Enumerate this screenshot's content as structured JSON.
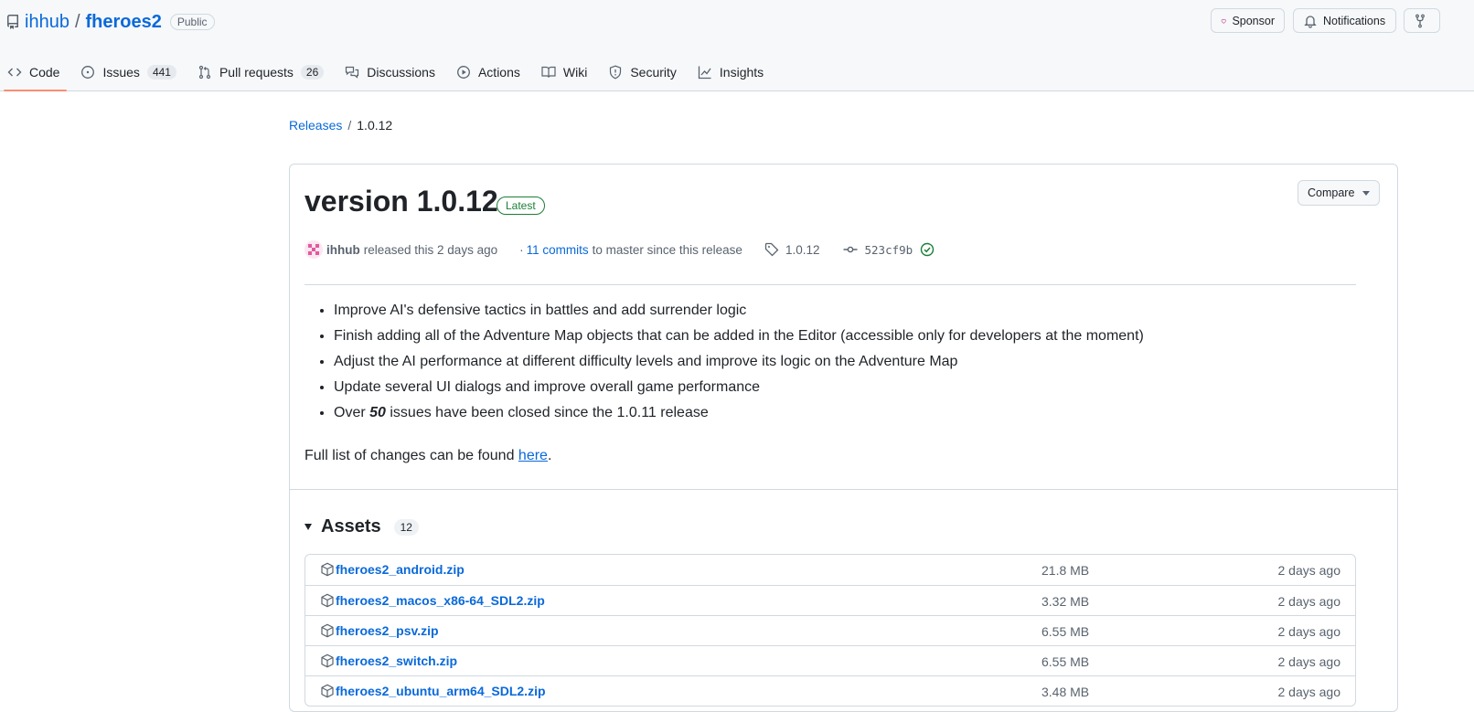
{
  "repo": {
    "owner": "ihhub",
    "separator": "/",
    "name": "fheroes2",
    "visibility": "Public",
    "icon": "repo-icon"
  },
  "header_actions": {
    "sponsor_label": "Sponsor",
    "notifications_label": "Notifications"
  },
  "tabs": [
    {
      "label": "Code",
      "icon": "code-icon",
      "count": null,
      "active": true
    },
    {
      "label": "Issues",
      "icon": "issue-icon",
      "count": "441",
      "active": false
    },
    {
      "label": "Pull requests",
      "icon": "pull-request-icon",
      "count": "26",
      "active": false
    },
    {
      "label": "Discussions",
      "icon": "comment-discussion-icon",
      "count": null,
      "active": false
    },
    {
      "label": "Actions",
      "icon": "play-icon",
      "count": null,
      "active": false
    },
    {
      "label": "Wiki",
      "icon": "book-icon",
      "count": null,
      "active": false
    },
    {
      "label": "Security",
      "icon": "shield-icon",
      "count": null,
      "active": false
    },
    {
      "label": "Insights",
      "icon": "graph-icon",
      "count": null,
      "active": false
    }
  ],
  "breadcrumb": {
    "releases_label": "Releases",
    "separator": "/",
    "current": "1.0.12"
  },
  "release": {
    "title": "version 1.0.12",
    "badge": "Latest",
    "compare_label": "Compare",
    "author": "ihhub",
    "released_text": "released this 2 days ago",
    "dot": "·",
    "commits_link": "11 commits",
    "commits_suffix": "to master since this release",
    "tag": "1.0.12",
    "commit_sha": "523cf9b",
    "notes_parts": [
      {
        "text": "Improve AI's defensive tactics in battles and add surrender logic"
      },
      {
        "text": "Finish adding all of the Adventure Map objects that can be added in the Editor (accessible only for developers at the moment)"
      },
      {
        "text": "Adjust the AI performance at different difficulty levels and improve its logic on the Adventure Map"
      },
      {
        "text": "Update several UI dialogs and improve overall game performance"
      }
    ],
    "last_note": {
      "prefix": "Over ",
      "emphasis": "50",
      "suffix": " issues have been closed since the 1.0.11 release"
    },
    "full_list": {
      "prefix": "Full list of changes can be found ",
      "link": "here",
      "suffix": "."
    }
  },
  "assets": {
    "title": "Assets",
    "count": "12",
    "items": [
      {
        "name": "fheroes2_android.zip",
        "size": "21.8 MB",
        "date": "2 days ago"
      },
      {
        "name": "fheroes2_macos_x86-64_SDL2.zip",
        "size": "3.32 MB",
        "date": "2 days ago"
      },
      {
        "name": "fheroes2_psv.zip",
        "size": "6.55 MB",
        "date": "2 days ago"
      },
      {
        "name": "fheroes2_switch.zip",
        "size": "6.55 MB",
        "date": "2 days ago"
      },
      {
        "name": "fheroes2_ubuntu_arm64_SDL2.zip",
        "size": "3.48 MB",
        "date": "2 days ago"
      }
    ]
  },
  "colors": {
    "accent": "#0969da",
    "tab_underline": "#fd8c73",
    "success": "#1a7f37",
    "sponsor_heart": "#bf3989"
  }
}
